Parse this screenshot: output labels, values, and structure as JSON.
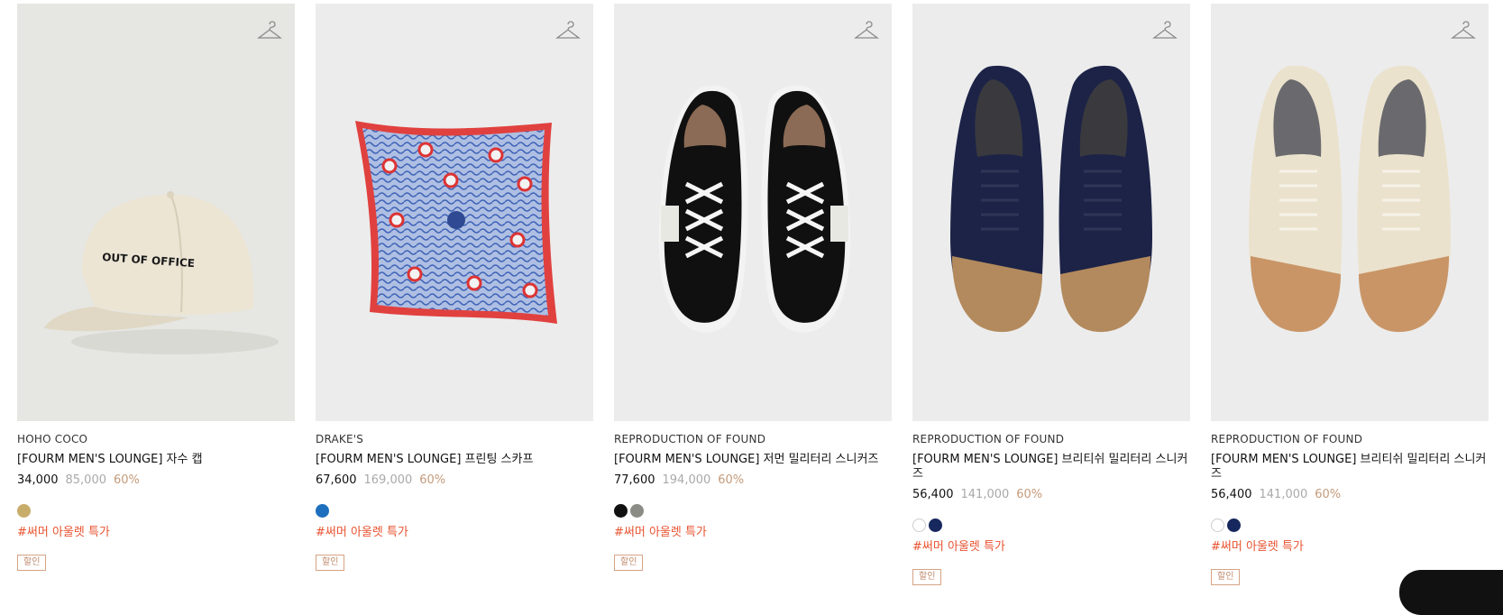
{
  "products": [
    {
      "brand": "HOHO COCO",
      "name": "[FOURM MEN'S LOUNGE] 자수 캡",
      "price": "34,000",
      "original_price": "85,000",
      "discount": "60%",
      "swatches": [
        "#c8ad6a"
      ],
      "tag": "#써머 아울렛 특가",
      "badge": "할인",
      "image": "cap",
      "cap_text": "OUT OF OFFICE"
    },
    {
      "brand": "DRAKE'S",
      "name": "[FOURM MEN'S LOUNGE] 프린팅 스카프",
      "price": "67,600",
      "original_price": "169,000",
      "discount": "60%",
      "swatches": [
        "#1e6fbe"
      ],
      "tag": "#써머 아울렛 특가",
      "badge": "할인",
      "image": "scarf"
    },
    {
      "brand": "REPRODUCTION OF FOUND",
      "name": "[FOURM MEN'S LOUNGE] 저먼 밀리터리 스니커즈",
      "price": "77,600",
      "original_price": "194,000",
      "discount": "60%",
      "swatches": [
        "#111111",
        "#8c8c86"
      ],
      "tag": "#써머 아울렛 특가",
      "badge": "할인",
      "image": "sneaker-black"
    },
    {
      "brand": "REPRODUCTION OF FOUND",
      "name": "[FOURM MEN'S LOUNGE] 브리티쉬 밀리터리 스니커즈",
      "price": "56,400",
      "original_price": "141,000",
      "discount": "60%",
      "swatches": [
        "#ffffff",
        "#17285e"
      ],
      "tag": "#써머 아울렛 특가",
      "badge": "할인",
      "image": "sneaker-navy"
    },
    {
      "brand": "REPRODUCTION OF FOUND",
      "name": "[FOURM MEN'S LOUNGE] 브리티쉬 밀리터리 스니커즈",
      "price": "56,400",
      "original_price": "141,000",
      "discount": "60%",
      "swatches": [
        "#ffffff",
        "#17285e"
      ],
      "tag": "#써머 아울렛 특가",
      "badge": "할인",
      "image": "sneaker-cream"
    }
  ],
  "icons": {
    "wishlist": "hanger-icon"
  },
  "colors": {
    "tag": "#e85330",
    "discount": "#c49a7a",
    "badge_border": "#d6a384"
  }
}
